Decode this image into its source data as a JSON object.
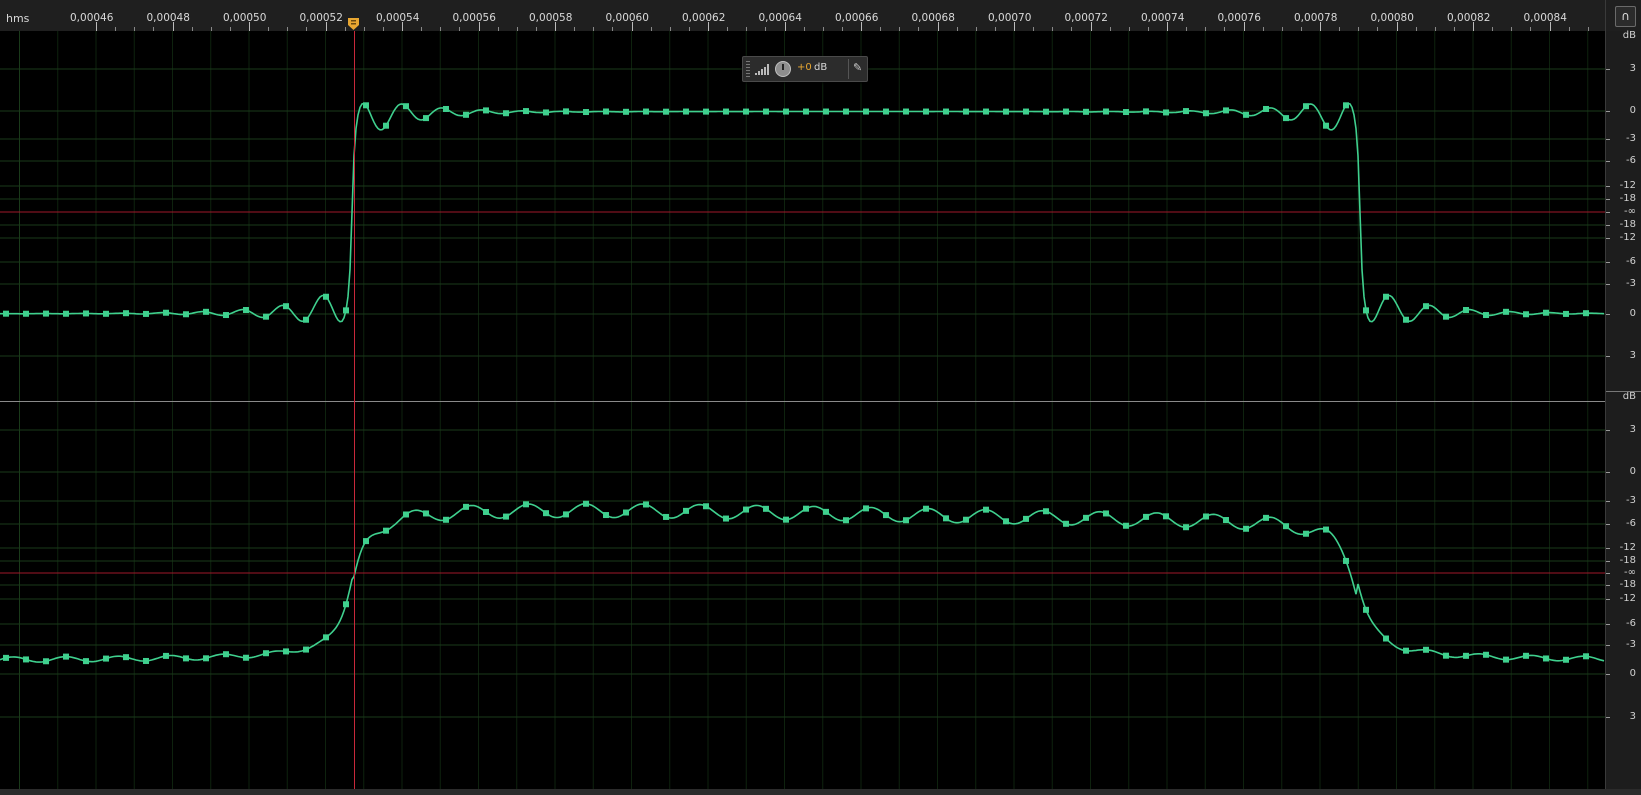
{
  "ruler": {
    "unit_label": "hms",
    "ticks": [
      "0,00046",
      "0,00048",
      "0,00050",
      "0,00052",
      "0,00054",
      "0,00056",
      "0,00058",
      "0,00060",
      "0,00062",
      "0,00064",
      "0,00066",
      "0,00068",
      "0,00070",
      "0,00072",
      "0,00074",
      "0,00076",
      "0,00078",
      "0,00080",
      "0,00082",
      "0,00084"
    ]
  },
  "hud": {
    "value": "+0",
    "unit": "dB",
    "volume_icon": "signal-bars-icon",
    "knob_icon": "knob-icon",
    "pin_icon": "pin-icon"
  },
  "db_scale": {
    "unit": "dB",
    "labels": [
      "3",
      "0",
      "-3",
      "-6",
      "-12",
      "-18",
      "-∞",
      "-18",
      "-12",
      "-6",
      "-3",
      "0",
      "3"
    ]
  },
  "colors": {
    "background": "#000000",
    "waveform": "#3fd08e",
    "grid": "#1a3a1a",
    "center_line": "#a0182a",
    "cursor": "#c8283a",
    "playhead_marker": "#e8a732"
  },
  "selection": {
    "cursor_time": "0,000526"
  },
  "channels": [
    {
      "name": "top",
      "shape": "square pulse with ringing (sinc interpolation)",
      "low_level": "0",
      "high_level": "0"
    },
    {
      "name": "bottom",
      "shape": "smoothed pulse"
    }
  ]
}
